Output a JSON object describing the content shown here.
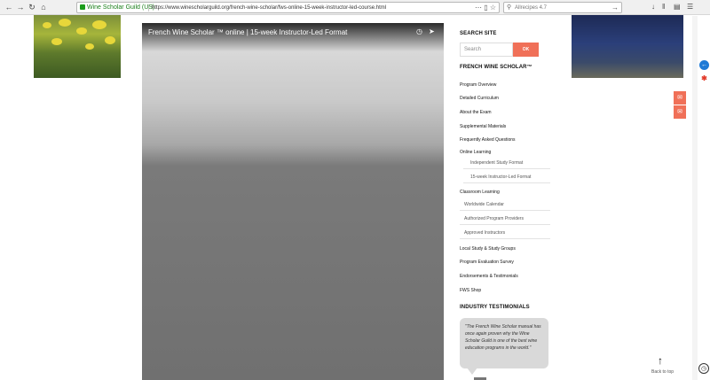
{
  "browser": {
    "back_icon": "back-arrow-icon",
    "forward_icon": "forward-arrow-icon",
    "reload_icon": "reload-icon",
    "home_icon": "home-icon",
    "site_identity": "Wine Scholar Guild (US)",
    "url": "https://www.winescholarguild.org/french-wine-scholar/fws-online-15-week-instructor-led-course.html",
    "search_text": "Allrecipes 4.7",
    "toolbar_icons": [
      "download-icon",
      "library-icon",
      "sidebar-icon",
      "menu-icon"
    ]
  },
  "video": {
    "title": "French Wine Scholar ™ online | 15-week Instructor-Led Format"
  },
  "sidebar": {
    "search_heading": "SEARCH SITE",
    "search_placeholder": "Search",
    "search_button": "OK",
    "program_heading": "FRENCH WINE SCHOLAR™",
    "menu": [
      {
        "label": "Program Overview"
      },
      {
        "label": "Detailed Curriculum"
      },
      {
        "label": "About the Exam"
      },
      {
        "label": "Supplemental Materials"
      },
      {
        "label": "Frequently Asked Questions"
      },
      {
        "label": "Online Learning"
      }
    ],
    "online_sub": [
      {
        "label": "Independent Study Format"
      },
      {
        "label": "15-week Instructor-Led Format"
      }
    ],
    "classroom_label": "Classroom Learning",
    "classroom_sub": [
      {
        "label": "Worldwide Calendar"
      },
      {
        "label": "Authorized Program Providers"
      },
      {
        "label": "Approved Instructors"
      }
    ],
    "menu2": [
      {
        "label": "Local Study & Study Groups"
      },
      {
        "label": "Program Evaluation Survey"
      },
      {
        "label": "Endorsements & Testimonials"
      },
      {
        "label": "FWS Shop"
      }
    ],
    "testimonials_heading": "INDUSTRY TESTIMONIALS",
    "testimonial_text": "\"The French Wine Scholar manual has once again proven why the Wine Scholar Guild is one of the best wine education programs in the world.\""
  },
  "floating": {
    "chat_icon": "chat-icon",
    "mail_icon": "mail-icon",
    "scroll_label": "Back to top"
  }
}
